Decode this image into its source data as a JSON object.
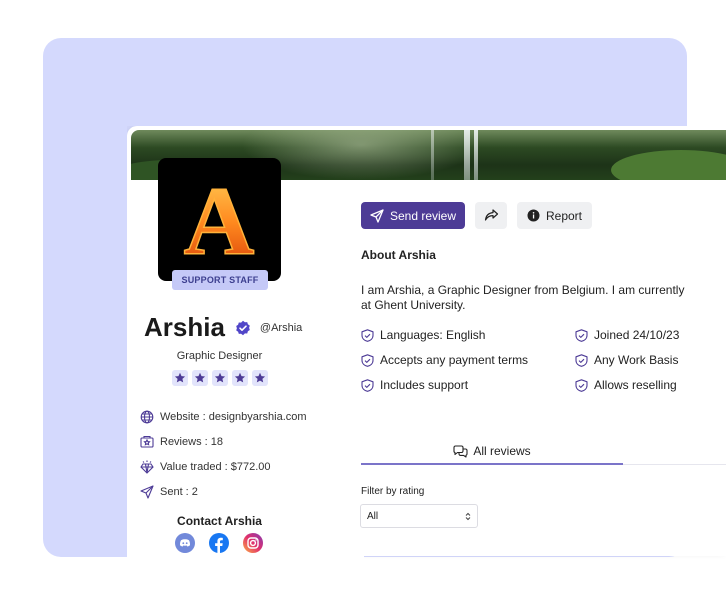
{
  "profile": {
    "badge": "SUPPORT STAFF",
    "name": "Arshia",
    "handle": "@Arshia",
    "role": "Graphic Designer",
    "rating": 5,
    "avatar_letter": "A",
    "stats": [
      {
        "icon": "globe-icon",
        "label": "Website : designbyarshia.com"
      },
      {
        "icon": "reviews-icon",
        "label": "Reviews : 18"
      },
      {
        "icon": "diamond-icon",
        "label": "Value traded : $772.00"
      },
      {
        "icon": "send-icon",
        "label": "Sent : 2"
      }
    ],
    "contact_title": "Contact Arshia",
    "socials": [
      {
        "name": "discord-icon",
        "color": "#7289da"
      },
      {
        "name": "facebook-icon",
        "color": "#1877f2"
      },
      {
        "name": "instagram-icon",
        "color": "#d6249f"
      }
    ]
  },
  "actions": {
    "send_review": "Send review",
    "share": "share-icon",
    "report": "Report"
  },
  "about": {
    "title": "About Arshia",
    "text_line1": "I am Arshia, a Graphic Designer from Belgium. I am currently",
    "text_line2": "at Ghent University.",
    "features_left": [
      "Languages: English",
      "Accepts any payment terms",
      "Includes support"
    ],
    "features_right": [
      "Joined 24/10/23",
      "Any Work Basis",
      "Allows reselling"
    ]
  },
  "reviews": {
    "tab_label": "All reviews",
    "filter_label": "Filter by rating",
    "filter_value": "All"
  },
  "colors": {
    "accent": "#4d3b96",
    "background": "#d4d9fd",
    "badge_bg": "#c5c9f7"
  }
}
